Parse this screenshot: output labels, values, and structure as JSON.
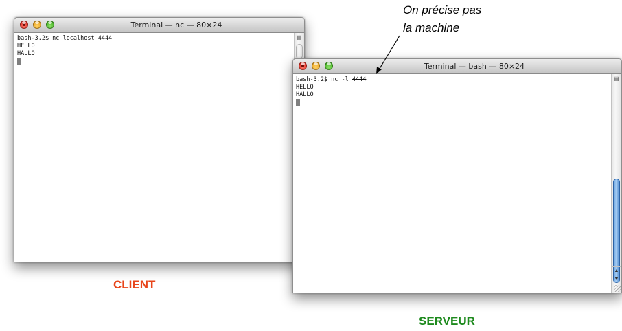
{
  "client_window": {
    "title": "Terminal — nc — 80×24",
    "lines": {
      "prompt": "bash-3.2$ nc localhost ",
      "port": "4444",
      "line2": "HELLO",
      "line3": "HALLO"
    }
  },
  "server_window": {
    "title": "Terminal — bash — 80×24",
    "lines": {
      "prompt": "bash-3.2$ nc -l ",
      "port": "4444",
      "line2": "HELLO",
      "line3": "HALLO"
    }
  },
  "captions": {
    "client": "CLIENT",
    "server": "SERVEUR"
  },
  "annotation": {
    "line1": "On précise pas",
    "line2": "la machine"
  },
  "colors": {
    "client_caption": "#e8451a",
    "server_caption": "#1e8a1e",
    "scroll_thumb": "#4b8fd6",
    "cursor": "#7f7f7f"
  },
  "icons": {
    "close": "close-icon",
    "minimize": "minimize-icon",
    "zoom": "zoom-icon",
    "split": "split-pane-icon",
    "scroll_up": "arrow-up-icon",
    "scroll_down": "arrow-down-icon",
    "resize": "resize-grip-icon"
  }
}
